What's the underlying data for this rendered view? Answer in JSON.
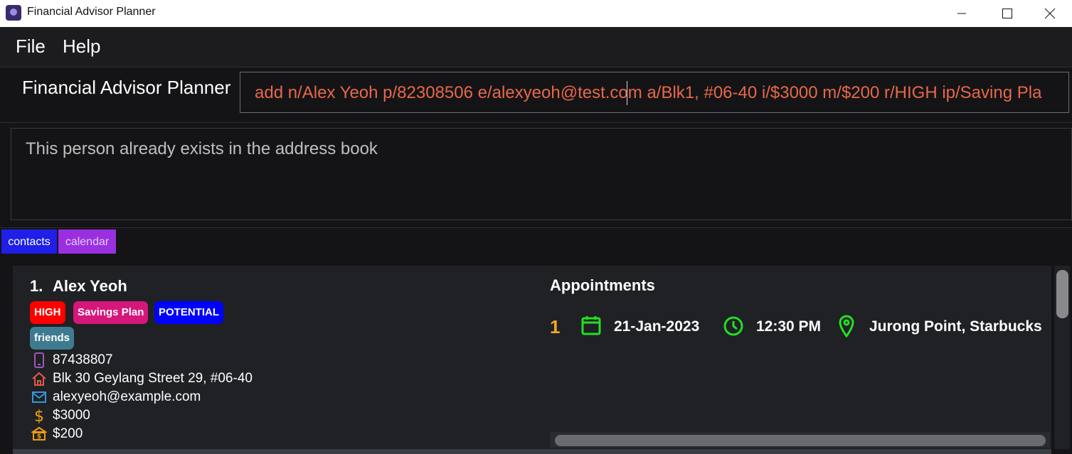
{
  "window": {
    "title": "Financial Advisor Planner"
  },
  "menu": {
    "file": "File",
    "help": "Help"
  },
  "command": {
    "label": "Financial Advisor Planner",
    "value": "add n/Alex Yeoh p/82308506 e/alexyeoh@test.com a/Blk1, #06-40 i/$3000 m/$200 r/HIGH ip/Saving Pla"
  },
  "result": {
    "text": "This person already exists in the address book"
  },
  "tabs": {
    "contacts": "contacts",
    "calendar": "calendar"
  },
  "person": {
    "index": "1.",
    "name": "Alex Yeoh",
    "tags": [
      {
        "text": "HIGH",
        "color": "#ff0000"
      },
      {
        "text": "Savings Plan",
        "color": "#d6177a"
      },
      {
        "text": "POTENTIAL",
        "color": "#0000ff"
      },
      {
        "text": "friends",
        "color": "#3e7b91"
      }
    ],
    "phone": "87438807",
    "address": "Blk 30 Geylang Street 29, #06-40",
    "email": "alexyeoh@example.com",
    "income": "$3000",
    "monthly": "$200",
    "icon_colors": {
      "phone": "#9b59b6",
      "address": "#e05a47",
      "email": "#3498db",
      "income": "#f39c12",
      "monthly": "#f39c12"
    }
  },
  "appointments": {
    "title": "Appointments",
    "items": [
      {
        "num": "1",
        "date": "21-Jan-2023",
        "time": "12:30 PM",
        "location": "Jurong Point, Starbucks"
      }
    ],
    "icon_color": "#22e022",
    "num_color": "#f6a623"
  }
}
